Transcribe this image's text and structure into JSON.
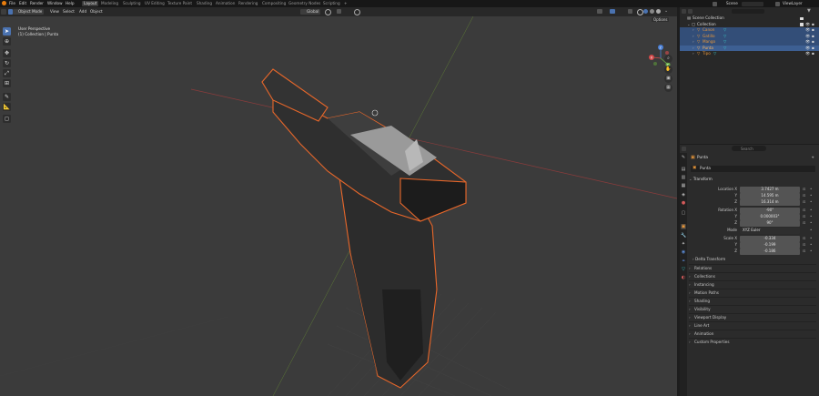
{
  "topbar": {
    "menus": [
      "File",
      "Edit",
      "Render",
      "Window",
      "Help"
    ],
    "workspaces": [
      "Layout",
      "Modeling",
      "Sculpting",
      "UV Editing",
      "Texture Paint",
      "Shading",
      "Animation",
      "Rendering",
      "Compositing",
      "Geometry Nodes",
      "Scripting"
    ],
    "active_workspace": "Layout",
    "add_tab": "+",
    "scene_name": "Scene",
    "view_layer": "ViewLayer"
  },
  "viewport_header": {
    "mode": "Object Mode",
    "menus": [
      "View",
      "Select",
      "Add",
      "Object"
    ],
    "transform_orientation": "Global",
    "options_label": "Options"
  },
  "viewport": {
    "view_name": "User Perspective",
    "collection_path": "(1) Collection | Punta",
    "gizmo_axes": [
      "X",
      "Y",
      "Z"
    ]
  },
  "outliner": {
    "search_placeholder": "",
    "root": "Scene Collection",
    "collection": "Collection",
    "objects": [
      {
        "name": "Canon",
        "selected": true
      },
      {
        "name": "Gatillo",
        "selected": true
      },
      {
        "name": "Mango",
        "selected": true
      },
      {
        "name": "Punta",
        "selected": true,
        "active": true
      },
      {
        "name": "Tipo",
        "selected": false
      }
    ]
  },
  "properties": {
    "search_placeholder": "Search",
    "object_title": "Punta",
    "object_name": "Punta",
    "sections": {
      "transform": "Transform",
      "delta": "Delta Transform"
    },
    "location": {
      "label": "Location X",
      "x": "3.7427 m",
      "y": "14.595 m",
      "z": "16.314 m"
    },
    "rotation": {
      "label": "Rotation X",
      "x": "-90°",
      "y": "0.000003°",
      "z": "90°"
    },
    "mode": {
      "label": "Mode",
      "value": "XYZ Euler"
    },
    "scale": {
      "label": "Scale X",
      "x": "-0.334",
      "y": "-0.199",
      "z": "-0.186"
    },
    "axis_y": "Y",
    "axis_z": "Z",
    "collapsed_panels": [
      "Relations",
      "Collections",
      "Instancing",
      "Motion Paths",
      "Shading",
      "Visibility",
      "Viewport Display",
      "Line Art",
      "Animation",
      "Custom Properties"
    ]
  },
  "colors": {
    "accent": "#4a72b0",
    "selection_outline": "#e8672a",
    "object_orange": "#e8973a",
    "mesh_teal": "#38c6c6"
  }
}
